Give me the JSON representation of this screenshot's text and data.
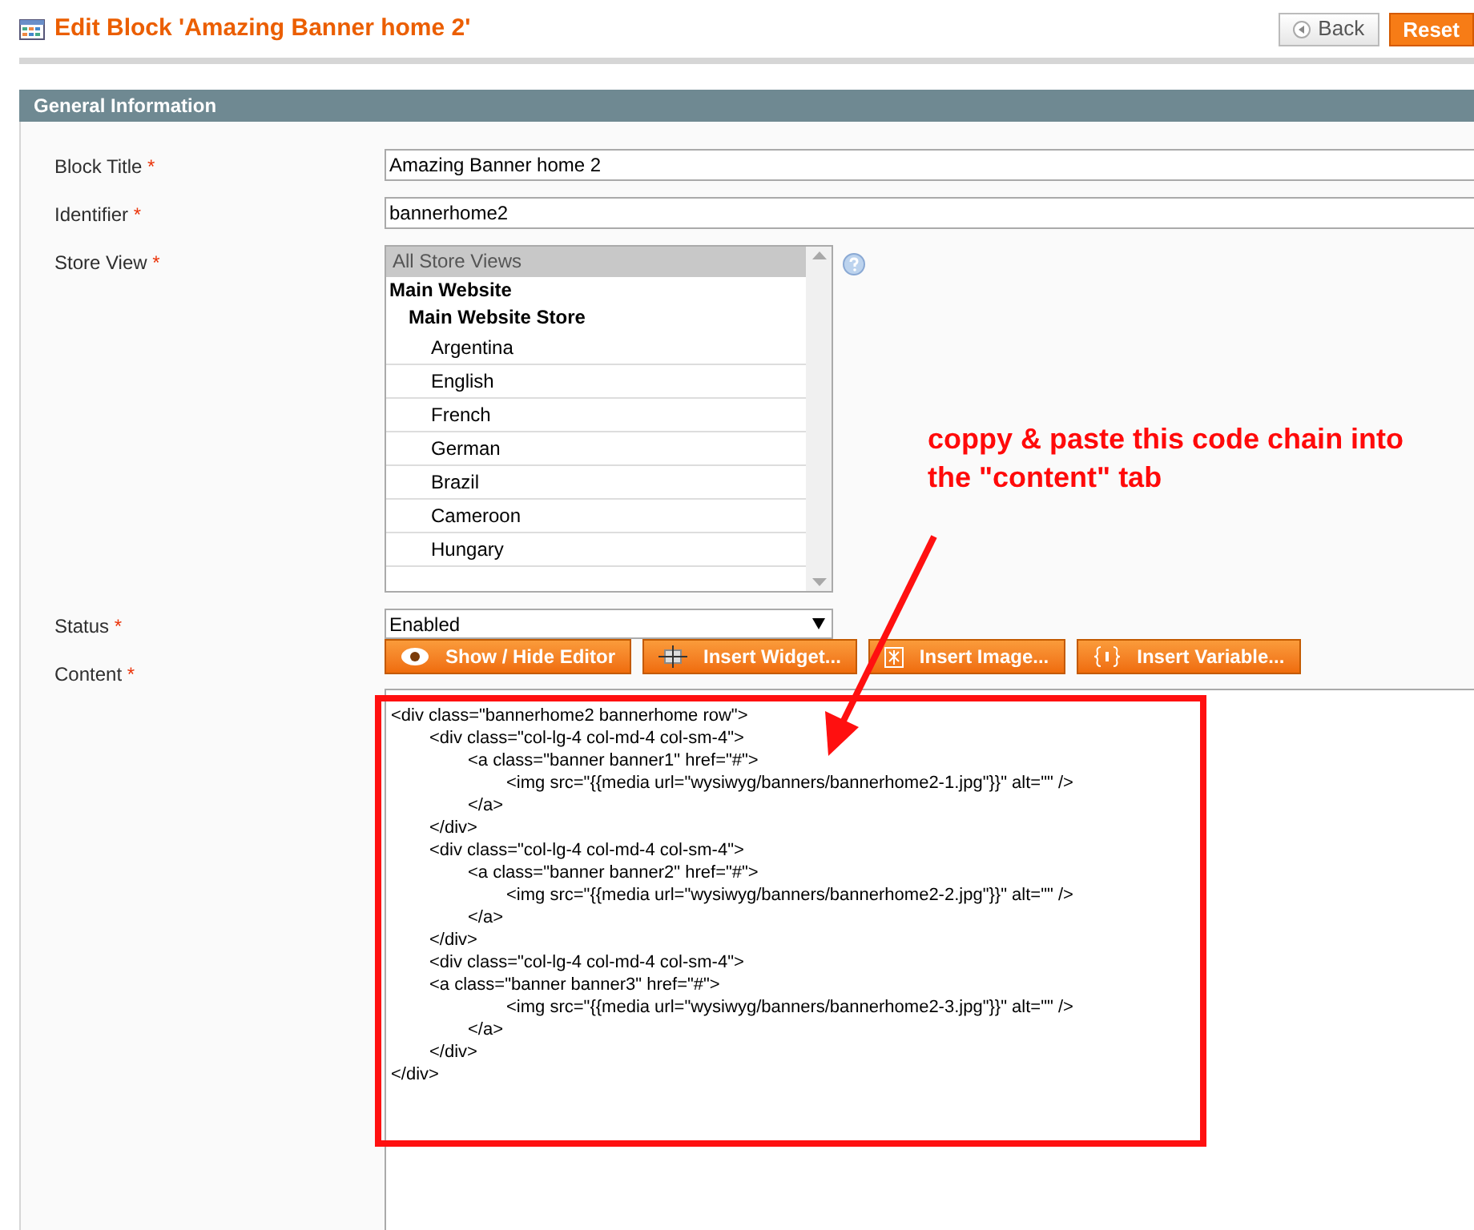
{
  "page_title": "Edit Block 'Amazing Banner home 2'",
  "header_buttons": [
    {
      "label": "Back",
      "kind": "back"
    },
    {
      "label": "Reset",
      "kind": "primary"
    }
  ],
  "section_title": "General Information",
  "fields": [
    {
      "label": "Block Title",
      "required_mark": "*",
      "kind": "text",
      "value": "Amazing Banner home 2"
    },
    {
      "label": "Identifier",
      "required_mark": "*",
      "kind": "text",
      "value": "bannerhome2"
    },
    {
      "label": "Store View",
      "required_mark": "*",
      "kind": "multiselect",
      "options": [
        {
          "label": "All Store Views",
          "selected": true
        },
        {
          "label": "Main Website",
          "children": [
            {
              "label": "Main Website Store",
              "children": [
                {
                  "label": "Argentina",
                  "selected": false
                },
                {
                  "label": "English",
                  "selected": false
                },
                {
                  "label": "French",
                  "selected": false
                },
                {
                  "label": "German",
                  "selected": false
                },
                {
                  "label": "Brazil",
                  "selected": false
                },
                {
                  "label": "Cameroon",
                  "selected": false
                },
                {
                  "label": "Hungary",
                  "selected": false
                }
              ]
            }
          ]
        }
      ]
    },
    {
      "label": "Status",
      "required_mark": "*",
      "kind": "select",
      "value": "Enabled"
    },
    {
      "label": "Content",
      "required_mark": "*",
      "kind": "editor",
      "buttons": [
        {
          "label": "Show / Hide Editor"
        },
        {
          "label": "Insert Widget..."
        },
        {
          "label": "Insert Image..."
        },
        {
          "label": "Insert Variable..."
        }
      ],
      "value": "<div class=\"bannerhome2 bannerhome row\">\n\t<div class=\"col-lg-4 col-md-4 col-sm-4\">\n\t\t<a class=\"banner banner1\" href=\"#\">\n\t\t\t<img src=\"{{media url=\"wysiwyg/banners/bannerhome2-1.jpg\"}}\" alt=\"\" />\n\t\t</a>\n\t</div>\n\t<div class=\"col-lg-4 col-md-4 col-sm-4\">\n\t\t<a class=\"banner banner2\" href=\"#\">\n\t\t\t<img src=\"{{media url=\"wysiwyg/banners/bannerhome2-2.jpg\"}}\" alt=\"\" />\n\t\t</a>\n\t</div>\n\t<div class=\"col-lg-4 col-md-4 col-sm-4\">\n\t<a class=\"banner banner3\" href=\"#\">\n\t\t\t<img src=\"{{media url=\"wysiwyg/banners/bannerhome2-3.jpg\"}}\" alt=\"\" />\n\t\t</a>\n\t</div>\n</div>"
    }
  ],
  "annotation": {
    "text": "coppy & paste this code chain into the \"content\" tab"
  }
}
